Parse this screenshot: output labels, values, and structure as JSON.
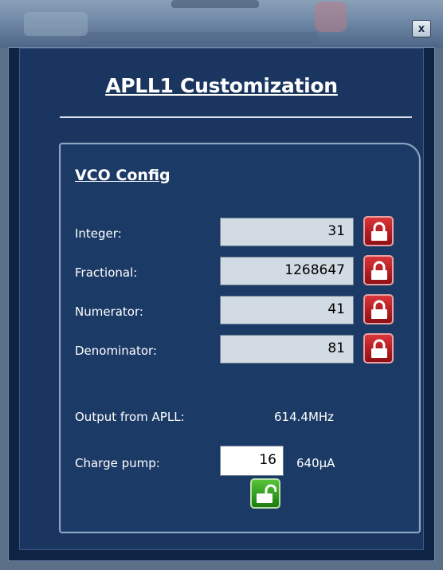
{
  "window": {
    "close_label": "x"
  },
  "dialog": {
    "title": "APLL1 Customization"
  },
  "vco": {
    "section_title": "VCO Config",
    "rows": [
      {
        "label": "Integer:",
        "value": "31",
        "lock": "locked"
      },
      {
        "label": "Fractional:",
        "value": "1268647",
        "lock": "locked"
      },
      {
        "label": "Numerator:",
        "value": "41",
        "lock": "locked"
      },
      {
        "label": "Denominator:",
        "value": "81",
        "lock": "locked"
      }
    ],
    "output_label": "Output from APLL:",
    "output_value": "614.4MHz",
    "charge_pump_label": "Charge pump:",
    "charge_pump_value": "16",
    "charge_pump_current": "640µA",
    "charge_pump_lock": "unlocked"
  },
  "colors": {
    "lock_locked": "#c0262c",
    "lock_unlocked": "#3aa422",
    "dialog_bg": "#1a3560"
  }
}
